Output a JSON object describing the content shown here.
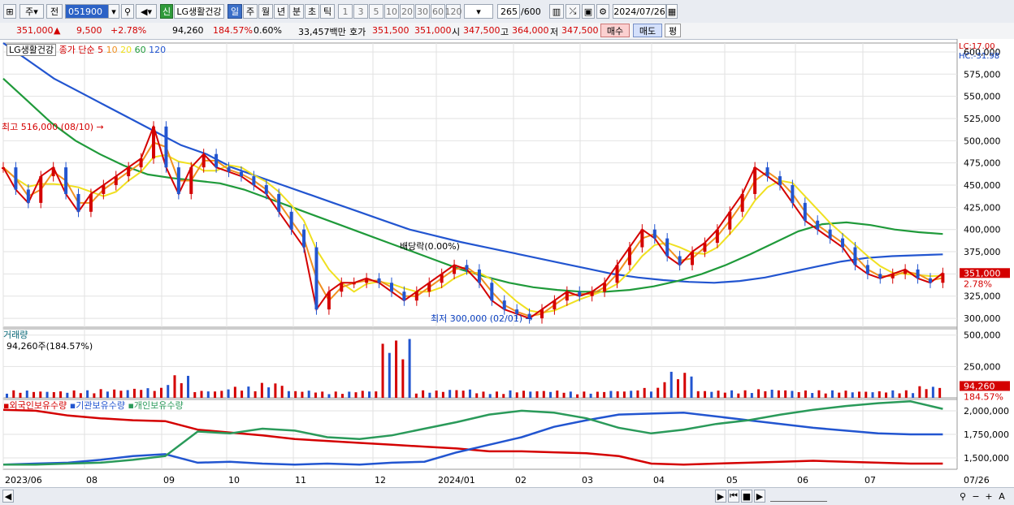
{
  "toolbar": {
    "market": "주",
    "range_type": "전",
    "stock_code": "051900",
    "stock_name": "LG생활건강",
    "credit_badge": "신",
    "periods": [
      "일",
      "주",
      "월",
      "년",
      "분",
      "초",
      "틱"
    ],
    "active_period": "일",
    "intervals": [
      "1",
      "3",
      "5",
      "10",
      "20",
      "30",
      "60",
      "120"
    ],
    "count": "265",
    "count_max": "/600",
    "date": "2024/07/26"
  },
  "infobar": {
    "price": "351,000",
    "change": "9,500",
    "change_pct": "+2.78%",
    "volume": "94,260",
    "volume_pct": "184.57%",
    "turnover_pct": "0.60%",
    "amount": "33,457백만",
    "quote_label": "호가",
    "ask": "351,500",
    "bid": "351,000",
    "open_label": "시",
    "open": "347,500",
    "high_label": "고",
    "high": "364,000",
    "low_label": "저",
    "low": "347,500",
    "buy_label": "매수",
    "sell_label": "매도",
    "avg_label": "평"
  },
  "price_panel": {
    "name_tag": "LG생활건강",
    "ma_label": "종가 단순",
    "ma_periods": [
      "5",
      "10",
      "20",
      "60",
      "120"
    ],
    "ma_colors": [
      "#d40000",
      "#f09020",
      "#f0e020",
      "#1f9a3a",
      "#2255d0"
    ],
    "lc": "LC:17.00",
    "hc": "HC:-31.98",
    "high_note": "최고 516,000 (08/10)",
    "low_note": "최저 300,000 (02/01)",
    "dividend_note": "배당락(0.00%)",
    "current_price_tag": "351,000",
    "current_pct_tag": "2.78%",
    "y_ticks": [
      "600,000",
      "575,000",
      "550,000",
      "525,000",
      "500,000",
      "475,000",
      "450,000",
      "425,000",
      "400,000",
      "375,000",
      "350,000",
      "325,000",
      "300,000"
    ]
  },
  "volume_panel": {
    "title": "거래량",
    "value": "94,260주(184.57%)",
    "y_ticks": [
      "500,000",
      "250,000"
    ],
    "tag_value": "94,260",
    "tag_pct": "184.57%"
  },
  "holdings_panel": {
    "series_labels": [
      "외국인보유수량",
      "기관보유수량",
      "개인보유수량"
    ],
    "series_colors": [
      "#d40000",
      "#2255d0",
      "#2a9a5a"
    ],
    "y_ticks": [
      "2,000,000",
      "1,750,000",
      "1,500,000"
    ]
  },
  "x_axis": {
    "labels": [
      "2023/06",
      "08",
      "09",
      "10",
      "11",
      "12",
      "2024/01",
      "02",
      "03",
      "04",
      "05",
      "06",
      "07"
    ],
    "right_label": "07/26"
  },
  "chart_data": {
    "type": "line",
    "title": "LG생활건강",
    "x_start": "2023/06",
    "x_end": "2024/07/26",
    "ylim": [
      290000,
      610000
    ],
    "series": [
      {
        "name": "종가",
        "values": [
          470000,
          445000,
          430000,
          460000,
          470000,
          440000,
          420000,
          440000,
          450000,
          460000,
          470000,
          480000,
          516000,
          470000,
          440000,
          470000,
          485000,
          470000,
          465000,
          460000,
          450000,
          440000,
          420000,
          400000,
          380000,
          310000,
          330000,
          340000,
          340000,
          345000,
          340000,
          330000,
          320000,
          330000,
          340000,
          350000,
          360000,
          355000,
          340000,
          320000,
          310000,
          305000,
          300000,
          310000,
          320000,
          330000,
          325000,
          330000,
          340000,
          360000,
          380000,
          400000,
          390000,
          370000,
          360000,
          375000,
          385000,
          400000,
          420000,
          440000,
          470000,
          460000,
          450000,
          430000,
          410000,
          400000,
          390000,
          380000,
          360000,
          350000,
          345000,
          350000,
          355000,
          345000,
          340000,
          351000
        ]
      },
      {
        "name": "120",
        "values": [
          610000,
          590000,
          570000,
          555000,
          540000,
          525000,
          510000,
          495000,
          485000,
          470000,
          460000,
          450000,
          440000,
          430000,
          420000,
          410000,
          400000,
          393000,
          386000,
          380000,
          374000,
          368000,
          362000,
          356000,
          350000,
          346000,
          343000,
          341000,
          340000,
          342000,
          346000,
          352000,
          358000,
          364000,
          368000,
          370000,
          371000,
          372000
        ]
      },
      {
        "name": "60",
        "values": [
          570000,
          545000,
          520000,
          500000,
          485000,
          472000,
          462000,
          458000,
          455000,
          452000,
          445000,
          435000,
          425000,
          415000,
          405000,
          395000,
          385000,
          375000,
          365000,
          355000,
          347000,
          340000,
          335000,
          332000,
          330000,
          330000,
          332000,
          336000,
          342000,
          350000,
          360000,
          372000,
          385000,
          398000,
          406000,
          408000,
          405000,
          400000,
          397000,
          395000
        ]
      },
      {
        "name": "거래량",
        "values": [
          60000,
          55000,
          60000,
          70000,
          80000,
          180000,
          60000,
          90000,
          120000,
          60000,
          50000,
          60000,
          470000,
          60000,
          70000,
          50000,
          60000,
          60000,
          50000,
          60000,
          80000,
          210000,
          60000,
          60000,
          70000,
          60000,
          60000,
          55000,
          60000,
          94260
        ]
      },
      {
        "name": "외국인보유수량",
        "values": [
          2010000,
          2000000,
          1950000,
          1920000,
          1900000,
          1890000,
          1800000,
          1770000,
          1740000,
          1700000,
          1680000,
          1660000,
          1640000,
          1620000,
          1600000,
          1570000,
          1570000,
          1560000,
          1550000,
          1520000,
          1440000,
          1430000,
          1440000,
          1450000,
          1460000,
          1470000,
          1460000,
          1450000,
          1440000,
          1440000
        ]
      },
      {
        "name": "기관보유수량",
        "values": [
          1430000,
          1440000,
          1450000,
          1480000,
          1520000,
          1540000,
          1450000,
          1460000,
          1440000,
          1430000,
          1440000,
          1430000,
          1450000,
          1460000,
          1560000,
          1640000,
          1720000,
          1830000,
          1900000,
          1960000,
          1970000,
          1980000,
          1940000,
          1900000,
          1860000,
          1820000,
          1790000,
          1760000,
          1750000,
          1750000
        ]
      },
      {
        "name": "개인보유수량",
        "values": [
          1430000,
          1430000,
          1440000,
          1450000,
          1480000,
          1520000,
          1780000,
          1760000,
          1810000,
          1790000,
          1720000,
          1700000,
          1740000,
          1810000,
          1880000,
          1960000,
          2000000,
          1980000,
          1920000,
          1820000,
          1760000,
          1800000,
          1860000,
          1900000,
          1960000,
          2010000,
          2050000,
          2080000,
          2100000,
          2020000
        ]
      }
    ]
  }
}
